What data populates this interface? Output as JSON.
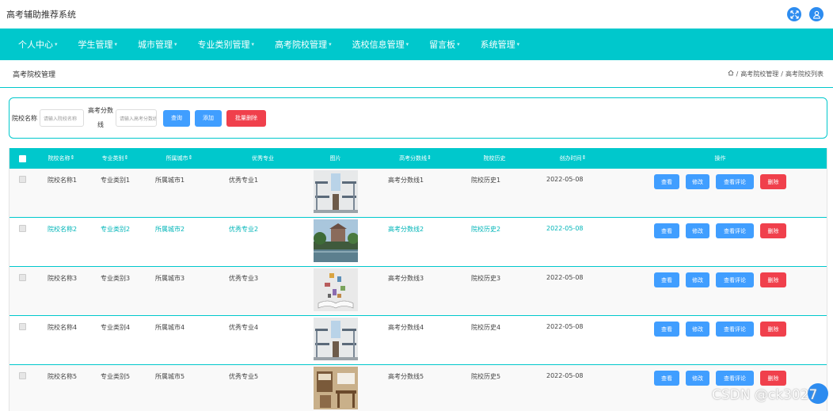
{
  "app": {
    "title": "高考辅助推荐系统"
  },
  "top_icons": [
    "fullscreen-icon",
    "user-icon"
  ],
  "nav": [
    {
      "label": "个人中心"
    },
    {
      "label": "学生管理"
    },
    {
      "label": "城市管理"
    },
    {
      "label": "专业类别管理"
    },
    {
      "label": "高考院校管理"
    },
    {
      "label": "选校信息管理"
    },
    {
      "label": "留言板"
    },
    {
      "label": "系统管理"
    }
  ],
  "page": {
    "title": "高考院校管理"
  },
  "breadcrumb": {
    "level1": "高考院校管理",
    "level2": "高考院校列表",
    "sep": "/"
  },
  "search": {
    "name_label": "院校名称",
    "name_placeholder": "请输入院校名称",
    "score_label_1": "高考分数",
    "score_label_2": "线",
    "score_placeholder": "请输入高考分数线",
    "query_label": "查询",
    "add_label": "添加",
    "batch_delete_label": "批量删除"
  },
  "table": {
    "headers": [
      "院校名称",
      "专业类别",
      "所属城市",
      "优秀专业",
      "图片",
      "高考分数线",
      "院校历史",
      "创办时间",
      "操作"
    ],
    "rows": [
      {
        "name": "院校名称1",
        "category": "专业类别1",
        "city": "所属城市1",
        "major": "优秀专业1",
        "image": "dorm-room-1",
        "score": "高考分数线1",
        "history": "院校历史1",
        "date": "2022-05-08"
      },
      {
        "name": "院校名称2",
        "category": "专业类别2",
        "city": "所属城市2",
        "major": "优秀专业2",
        "image": "campus-lake",
        "score": "高考分数线2",
        "history": "院校历史2",
        "date": "2022-05-08"
      },
      {
        "name": "院校名称3",
        "category": "专业类别3",
        "city": "所属城市3",
        "major": "优秀专业3",
        "image": "open-book",
        "score": "高考分数线3",
        "history": "院校历史3",
        "date": "2022-05-08"
      },
      {
        "name": "院校名称4",
        "category": "专业类别4",
        "city": "所属城市4",
        "major": "优秀专业4",
        "image": "dorm-room-2",
        "score": "高考分数线4",
        "history": "院校历史4",
        "date": "2022-05-08"
      },
      {
        "name": "院校名称5",
        "category": "专业类别5",
        "city": "所属城市5",
        "major": "优秀专业5",
        "image": "study-room",
        "score": "高考分数线5",
        "history": "院校历史5",
        "date": "2022-05-08"
      }
    ],
    "actions": {
      "view": "查看",
      "edit": "修改",
      "comments": "查看评论",
      "delete": "删除"
    }
  },
  "watermark": "CSDN @ck3027",
  "colors": {
    "accent": "#00c8cc",
    "primary": "#409eff",
    "danger": "#f0404c",
    "highlight_text": "#00b5b8"
  }
}
